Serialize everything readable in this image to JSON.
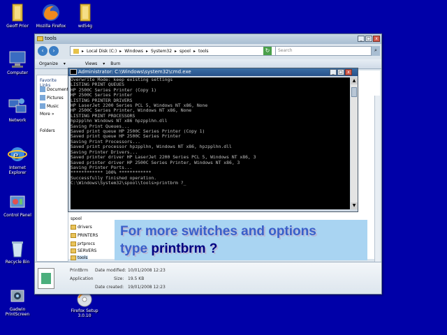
{
  "desktop": {
    "icons": [
      {
        "label": "Geoff Prior",
        "icon": "user-folder-icon"
      },
      {
        "label": "Mozilla Firefox",
        "icon": "firefox-icon"
      },
      {
        "label": "wd54g",
        "icon": "folder-icon"
      },
      {
        "label": "Computer",
        "icon": "computer-icon"
      },
      {
        "label": "Network",
        "icon": "network-icon"
      },
      {
        "label": "Internet Explorer",
        "icon": "internet-explorer-icon"
      },
      {
        "label": "Control Panel",
        "icon": "control-panel-icon"
      },
      {
        "label": "Recycle Bin",
        "icon": "recycle-bin-icon"
      },
      {
        "label": "Gadwin PrintScreen",
        "icon": "gadwin-icon"
      },
      {
        "label": "Firefox Setup 3.0.10",
        "icon": "installer-icon"
      }
    ]
  },
  "explorer": {
    "title": "tools",
    "address": [
      "Local Disk (C:)",
      "Windows",
      "System32",
      "spool",
      "tools"
    ],
    "search_placeholder": "Search",
    "toolbar": {
      "organize": "Organize",
      "views": "Views",
      "burn": "Burn"
    },
    "nav": {
      "favorite_links_title": "Favorite Links",
      "favorites": [
        "Documents",
        "Pictures",
        "Music",
        "More"
      ],
      "folders_label": "Folders"
    },
    "tree": [
      {
        "label": "spool",
        "selected": false
      },
      {
        "label": "drivers",
        "selected": false
      },
      {
        "label": "PRINTERS",
        "selected": false
      },
      {
        "label": "prtprocs",
        "selected": false
      },
      {
        "label": "SERVERS",
        "selected": false
      },
      {
        "label": "tools",
        "selected": true
      }
    ],
    "details": {
      "name": "PrintBrm",
      "date_modified_label": "Date modified:",
      "date_modified": "10/01/2008 12:23",
      "type": "Application",
      "size_label": "Size:",
      "size": "19.5 KB",
      "date_created_label": "Date created:",
      "date_created": "19/01/2008 12:23"
    }
  },
  "cmd": {
    "title": "Administrator: C:\\Windows\\system32\\cmd.exe",
    "lines": [
      "Overwrite Mode: keep existing settings",
      "",
      "LISTING PRINT QUEUES",
      "HP 2500C Series Printer (Copy 1)",
      "HP 2500C Series Printer",
      "LISTING PRINTER DRIVERS",
      "HP LaserJet 2200 Series PCL 5, Windows NT x86, None",
      "HP 2500C Series Printer, Windows NT x86, None",
      "LISTING PRINT PROCESSORS",
      "hpzpplhn Windows NT x86 hpzpplhn.dll",
      "",
      "Saving Print Queues...",
      "Saved print queue HP 2500C Series Printer (Copy 1)",
      "Saved print queue HP 2500C Series Printer",
      "Saving Print Processors...",
      "Saved print processor hpzpplhn, Windows NT x86, hpzpplhn.dll",
      "Saving Printer Drivers...",
      "Saved printer driver HP LaserJet 2200 Series PCL 5, Windows NT x86, 3",
      "Saved printer driver HP 2500C Series Printer, Windows NT x86, 3",
      "Saving Printer Ports...",
      "************ 100% ************",
      "",
      "Successfully finished operation.",
      "",
      "C:\\Windows\\System32\\spool\\tools>printbrm ?_"
    ]
  },
  "callout": {
    "line1": "For more switches and options",
    "line2_prefix": "type ",
    "line2_command": "printbrm ?"
  }
}
